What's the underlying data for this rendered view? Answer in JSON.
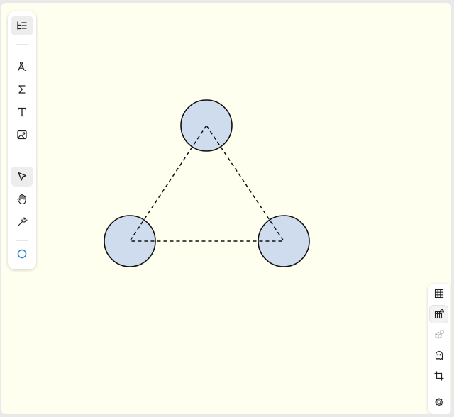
{
  "app": {
    "accent": "#2f7ec4",
    "canvas_background": "#fffff0",
    "shape_fill": "#cfdcee",
    "shape_stroke": "#111111"
  },
  "left_toolbar": {
    "tools": [
      {
        "name": "menu",
        "icon": "menu-list-icon",
        "active": true
      },
      {
        "name": "draw",
        "icon": "pen-nib-icon"
      },
      {
        "name": "formula",
        "icon": "sigma-icon"
      },
      {
        "name": "text",
        "icon": "text-t-icon"
      },
      {
        "name": "image",
        "icon": "image-icon"
      },
      {
        "name": "select",
        "icon": "cursor-arrow-icon",
        "active": true
      },
      {
        "name": "pan",
        "icon": "hand-icon"
      },
      {
        "name": "magic",
        "icon": "magic-wand-icon"
      },
      {
        "name": "shape",
        "icon": "circle-icon",
        "color": "#2f7ec4"
      }
    ]
  },
  "right_toolbar": {
    "tools": [
      {
        "name": "grid",
        "icon": "grid-icon"
      },
      {
        "name": "snap-to-grid",
        "icon": "grid-magnet-icon",
        "active": true
      },
      {
        "name": "snap-objects",
        "icon": "cube-magnet-icon",
        "disabled": true
      },
      {
        "name": "ghost",
        "icon": "ghost-icon"
      },
      {
        "name": "crop",
        "icon": "crop-icon"
      },
      {
        "name": "settings",
        "icon": "gear-icon"
      }
    ]
  },
  "canvas": {
    "shapes": [
      {
        "type": "circle",
        "fill": "#cfdcee",
        "stroke": "#111111"
      },
      {
        "type": "circle",
        "fill": "#cfdcee",
        "stroke": "#111111"
      },
      {
        "type": "circle",
        "fill": "#cfdcee",
        "stroke": "#111111"
      },
      {
        "type": "dashed-triangle",
        "stroke": "#111111"
      }
    ]
  }
}
